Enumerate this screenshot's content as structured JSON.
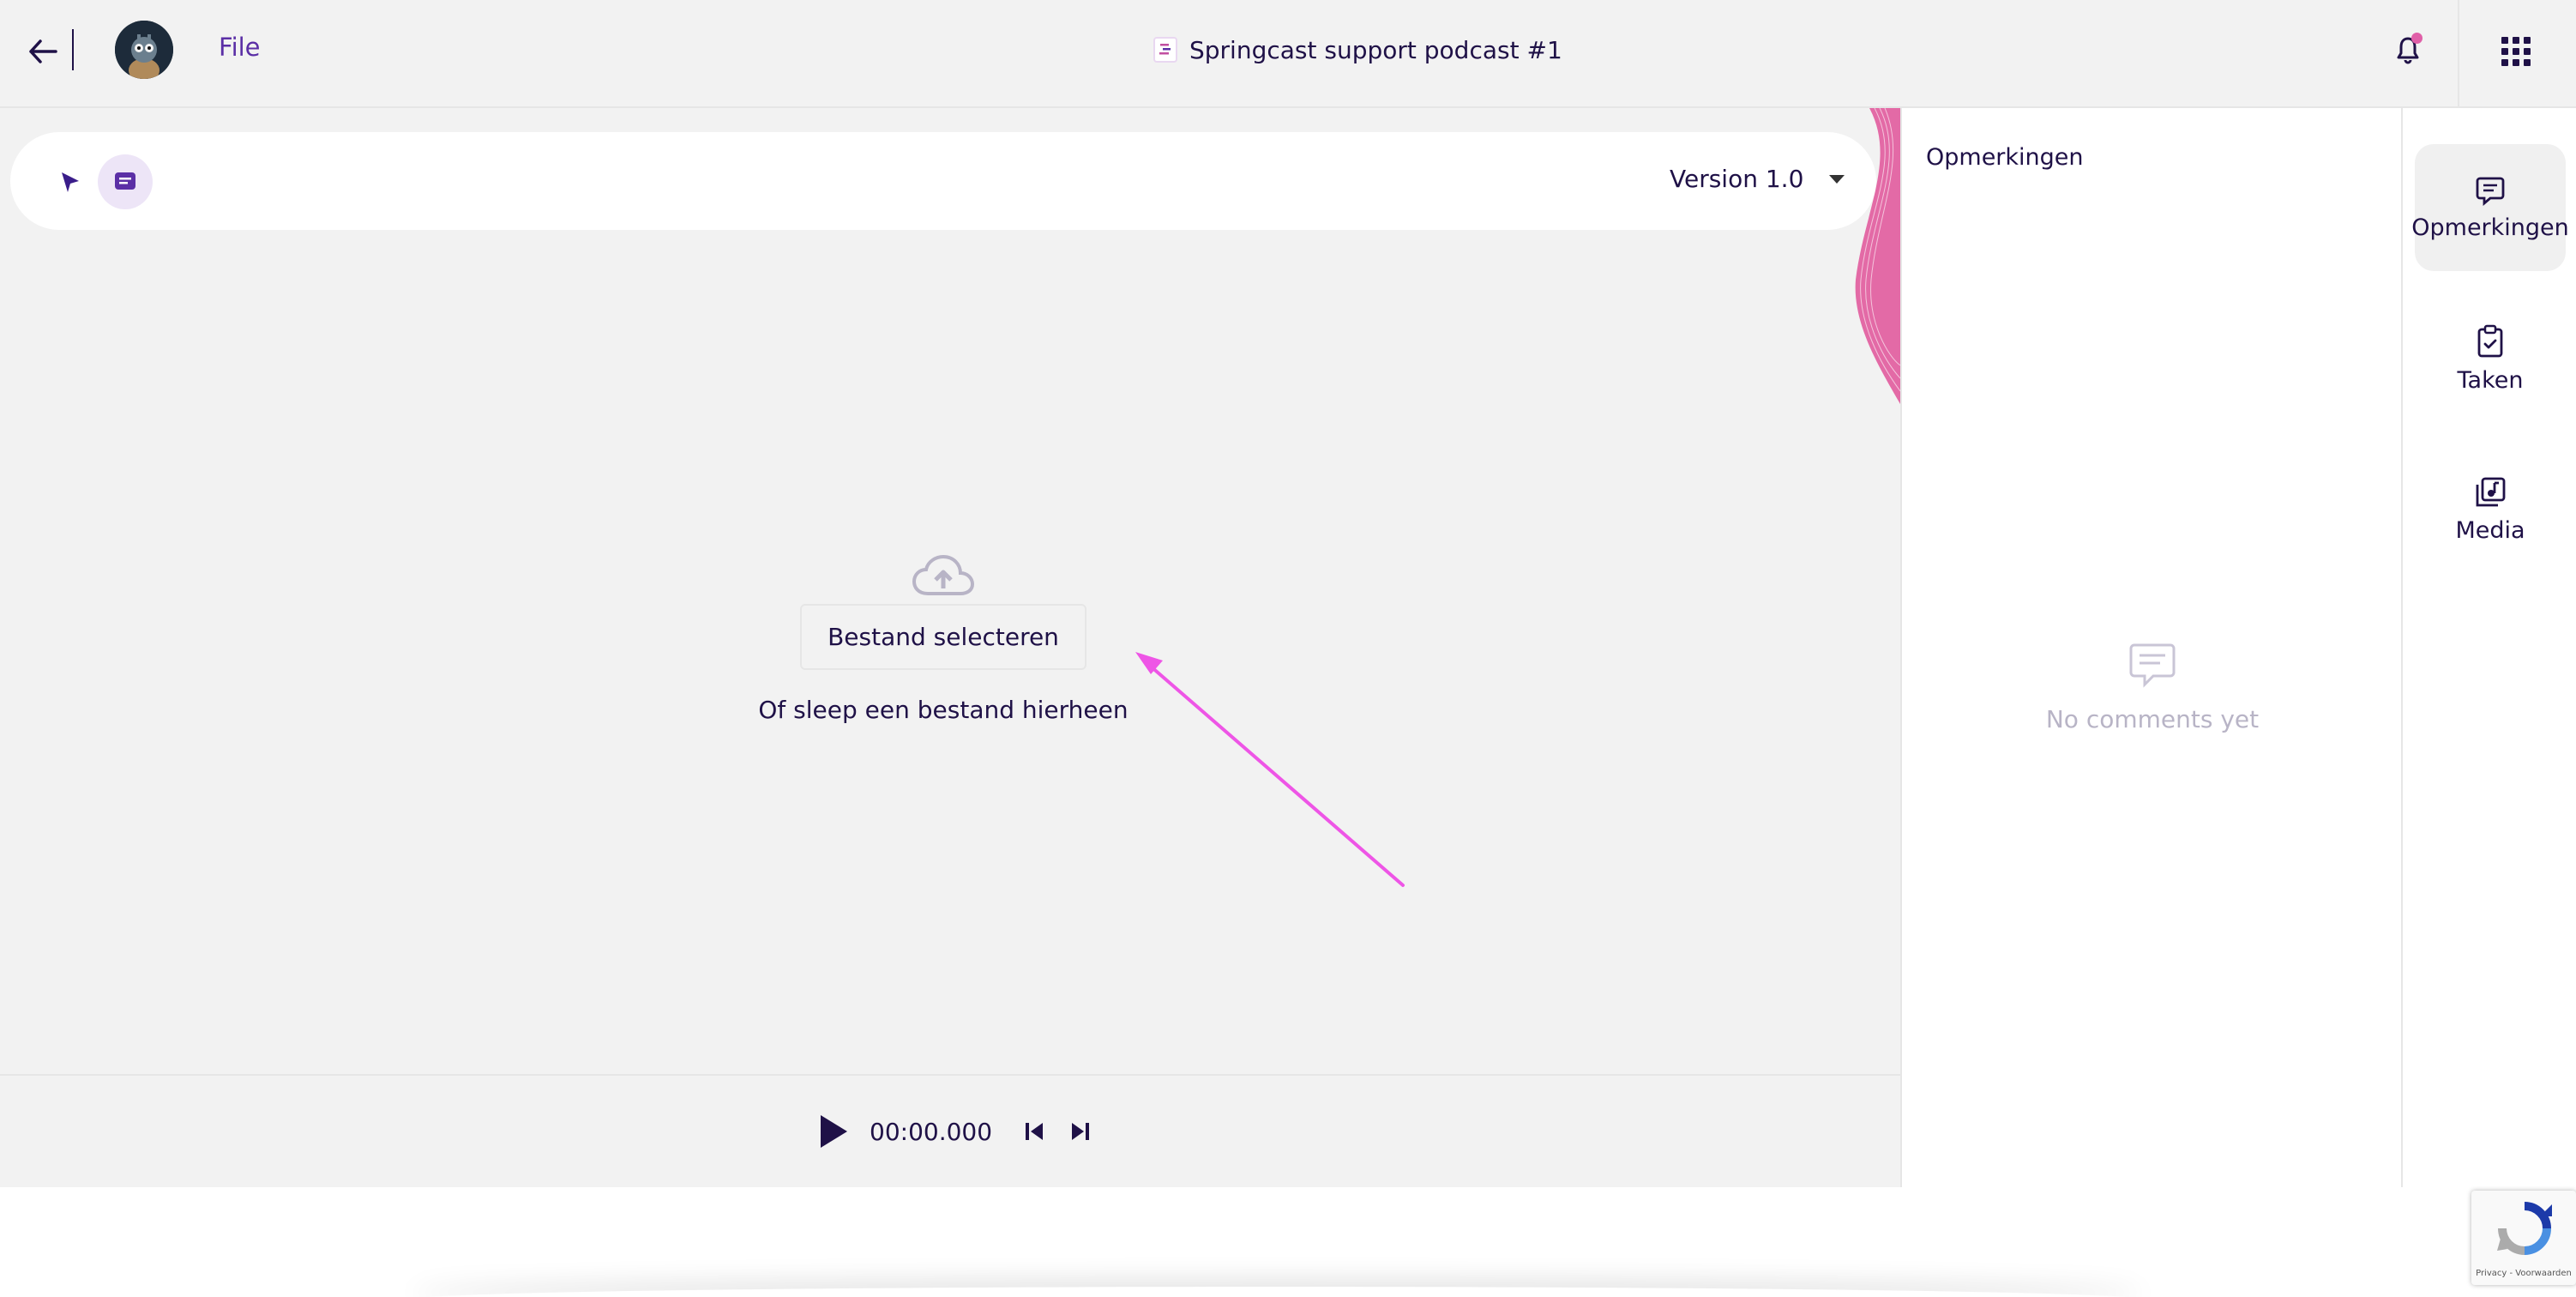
{
  "header": {
    "file_label": "File",
    "title": "Springcast support podcast #1"
  },
  "toolbar": {
    "version_label": "Version 1.0"
  },
  "upload": {
    "select_button": "Bestand selecteren",
    "drop_text": "Of sleep een bestand hierheen"
  },
  "player": {
    "time": "00:00.000"
  },
  "comments_panel": {
    "title": "Opmerkingen",
    "empty_text": "No comments yet"
  },
  "rail": {
    "items": [
      {
        "label": "Opmerkingen",
        "icon": "comment-icon",
        "active": true
      },
      {
        "label": "Taken",
        "icon": "clipboard-icon",
        "active": false
      },
      {
        "label": "Media",
        "icon": "media-library-icon",
        "active": false
      }
    ]
  },
  "recaptcha": {
    "text": "Privacy - Voorwaarden"
  },
  "colors": {
    "accent": "#5b2fa6",
    "text": "#1f1147",
    "annotation_arrow": "#ee55e6",
    "notification_dot": "#e05fa8",
    "background": "#f2f2f2"
  }
}
